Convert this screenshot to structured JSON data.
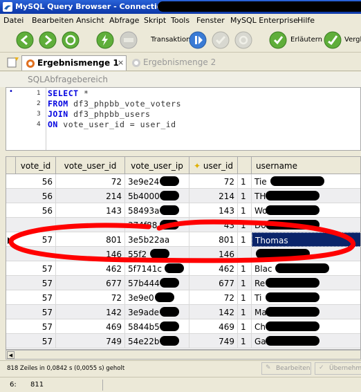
{
  "window": {
    "title": "MySQL Query Browser - Connection:"
  },
  "menu": [
    "Datei",
    "Bearbeiten",
    "Ansicht",
    "Abfrage",
    "Skript",
    "Tools",
    "Fenster",
    "MySQL Enterprise",
    "Hilfe"
  ],
  "toolbar": {
    "transaktion": "Transaktion",
    "erlaeutern": "Erläutern",
    "vergleich": "Vergle"
  },
  "tabs": {
    "active": "Ergebnismenge 1",
    "inactive": "Ergebnismenge 2",
    "close": "×"
  },
  "sql": {
    "header": "SQLAbfragebereich",
    "lines": [
      {
        "num": "1",
        "kw": "SELECT",
        "rest": " *"
      },
      {
        "num": "2",
        "kw": "FROM",
        "rest": " df3_phpbb_vote_voters"
      },
      {
        "num": "3",
        "kw": "JOIN",
        "rest": " df3_phpbb_users"
      },
      {
        "num": "4",
        "kw": "ON",
        "rest": " vote_user_id = user_id"
      }
    ]
  },
  "grid": {
    "columns": [
      "vote_id",
      "vote_user_id",
      "vote_user_ip",
      "user_id",
      "",
      "username"
    ],
    "rows": [
      {
        "vote_id": "56",
        "vote_user_id": "72",
        "ip": "3e9e24",
        "user_id": "72",
        "t": "1",
        "name": "Tie"
      },
      {
        "vote_id": "56",
        "vote_user_id": "214",
        "ip": "5b4000",
        "user_id": "214",
        "t": "1",
        "name": "TH"
      },
      {
        "vote_id": "56",
        "vote_user_id": "143",
        "ip": "58493a",
        "user_id": "143",
        "t": "1",
        "name": "Wo"
      },
      {
        "vote_id": "",
        "vote_user_id": "",
        "ip": "374f88",
        "user_id": "43",
        "t": "1",
        "name": "Do"
      },
      {
        "vote_id": "57",
        "vote_user_id": "801",
        "ip": "3e5b22aa",
        "user_id": "801",
        "t": "1",
        "name": "Thomas"
      },
      {
        "vote_id": "",
        "vote_user_id": "146",
        "ip": "55f2",
        "user_id": "146",
        "t": "",
        "name": ""
      },
      {
        "vote_id": "57",
        "vote_user_id": "462",
        "ip": "5f7141c",
        "user_id": "462",
        "t": "1",
        "name": "Blac"
      },
      {
        "vote_id": "57",
        "vote_user_id": "677",
        "ip": "57b444",
        "user_id": "677",
        "t": "1",
        "name": "Re"
      },
      {
        "vote_id": "57",
        "vote_user_id": "72",
        "ip": "3e9e0",
        "user_id": "72",
        "t": "1",
        "name": "Ti"
      },
      {
        "vote_id": "57",
        "vote_user_id": "142",
        "ip": "3e9ade",
        "user_id": "142",
        "t": "1",
        "name": "Ma"
      },
      {
        "vote_id": "57",
        "vote_user_id": "469",
        "ip": "5844b5",
        "user_id": "469",
        "t": "1",
        "name": "Ch"
      },
      {
        "vote_id": "57",
        "vote_user_id": "749",
        "ip": "54e22b",
        "user_id": "749",
        "t": "1",
        "name": "Ga"
      }
    ]
  },
  "status": {
    "message": "818 Zeiles in 0,0842 s (0,0055 s) geholt",
    "edit": "Bearbeiten",
    "apply": "Übernehm"
  },
  "bottom": {
    "position": "6:",
    "count": "811"
  },
  "colors": {
    "accent": "#0a246a",
    "highlight": "#ff0000"
  }
}
